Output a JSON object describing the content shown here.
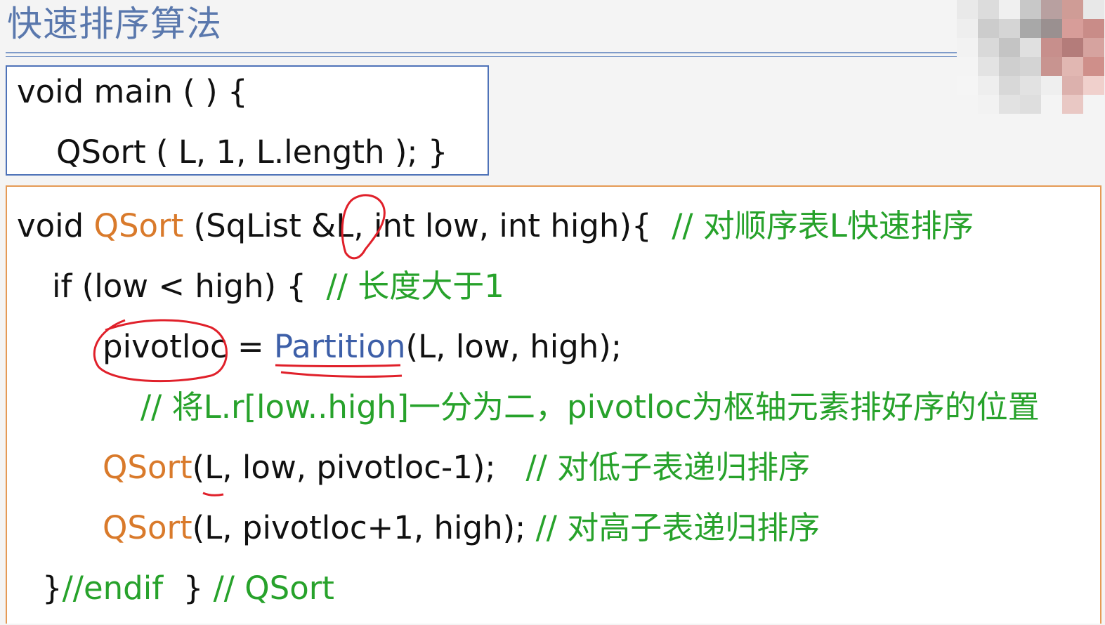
{
  "slide": {
    "title": "快速排序算法"
  },
  "main_box": {
    "line1": "void main ( ) {",
    "line2": "QSort ( L, 1, L.length ); }"
  },
  "qsort_box": {
    "line1": {
      "kw_void": "void ",
      "fn": "QSort",
      "params": " (SqList &L, int low, int high){  ",
      "comment": "// 对顺序表L快速排序"
    },
    "line2": {
      "code": "if (low < high) {  ",
      "comment": "// 长度大于1"
    },
    "line3": {
      "var": "pivotloc = ",
      "fn": "Partition",
      "args": "(L, low, high);"
    },
    "line4": {
      "comment": "// 将L.r[low..high]一分为二，pivotloc为枢轴元素排好序的位置"
    },
    "line5": {
      "fn": "QSort",
      "args": "(L, low, pivotloc-1);   ",
      "comment": "// 对低子表递归排序"
    },
    "line6": {
      "fn": "QSort",
      "args": "(L, pivotloc+1, high); ",
      "comment": "// 对高子表递归排序"
    },
    "line7": {
      "brace": "}",
      "comment1": "//endif  ",
      "brace2": "} ",
      "comment2": "// QSort"
    }
  },
  "colors": {
    "title": "#5a78ad",
    "keyword_fn": "#d97a2b",
    "partition": "#3d5fa8",
    "comment": "#27a22b",
    "annotation_ink": "#e0202a"
  },
  "webcam_feed": {
    "state": "pixelated"
  }
}
